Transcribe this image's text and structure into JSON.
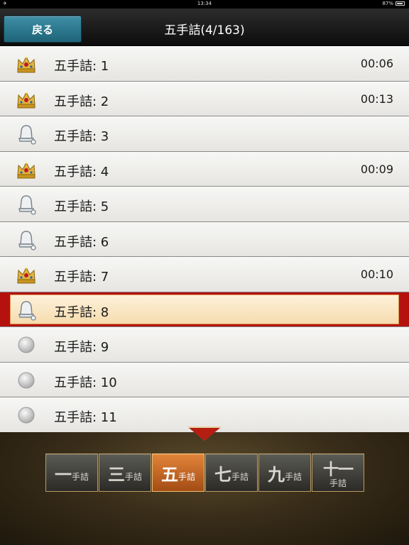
{
  "status_bar": {
    "left": "✈",
    "time": "13:34",
    "battery": "87%"
  },
  "header": {
    "back_label": "戻る",
    "title": "五手詰(4/163)"
  },
  "colors": {
    "accent_teal": "#2a7b91",
    "selected_red": "#b5120f",
    "active_tab": "#d27430"
  },
  "list": [
    {
      "label": "五手詰:  1",
      "time": "00:06",
      "icon": "crown-icon",
      "selected": false
    },
    {
      "label": "五手詰:  2",
      "time": "00:13",
      "icon": "crown-icon",
      "selected": false
    },
    {
      "label": "五手詰:  3",
      "time": "",
      "icon": "bell-icon",
      "selected": false
    },
    {
      "label": "五手詰:  4",
      "time": "00:09",
      "icon": "crown-icon",
      "selected": false
    },
    {
      "label": "五手詰:  5",
      "time": "",
      "icon": "bell-icon",
      "selected": false
    },
    {
      "label": "五手詰:  6",
      "time": "",
      "icon": "bell-icon",
      "selected": false
    },
    {
      "label": "五手詰:  7",
      "time": "00:10",
      "icon": "crown-icon",
      "selected": false
    },
    {
      "label": "五手詰:  8",
      "time": "",
      "icon": "bell-icon",
      "selected": true
    },
    {
      "label": "五手詰:  9",
      "time": "",
      "icon": "circle-icon",
      "selected": false
    },
    {
      "label": "五手詰:  10",
      "time": "",
      "icon": "circle-icon",
      "selected": false
    },
    {
      "label": "五手詰:  11",
      "time": "",
      "icon": "circle-icon",
      "selected": false
    }
  ],
  "tabs": [
    {
      "big": "一",
      "small": "手詰",
      "active": false
    },
    {
      "big": "三",
      "small": "手詰",
      "active": false
    },
    {
      "big": "五",
      "small": "手詰",
      "active": true
    },
    {
      "big": "七",
      "small": "手詰",
      "active": false
    },
    {
      "big": "九",
      "small": "手詰",
      "active": false
    },
    {
      "big": "十一",
      "small": "手詰",
      "active": false
    }
  ]
}
